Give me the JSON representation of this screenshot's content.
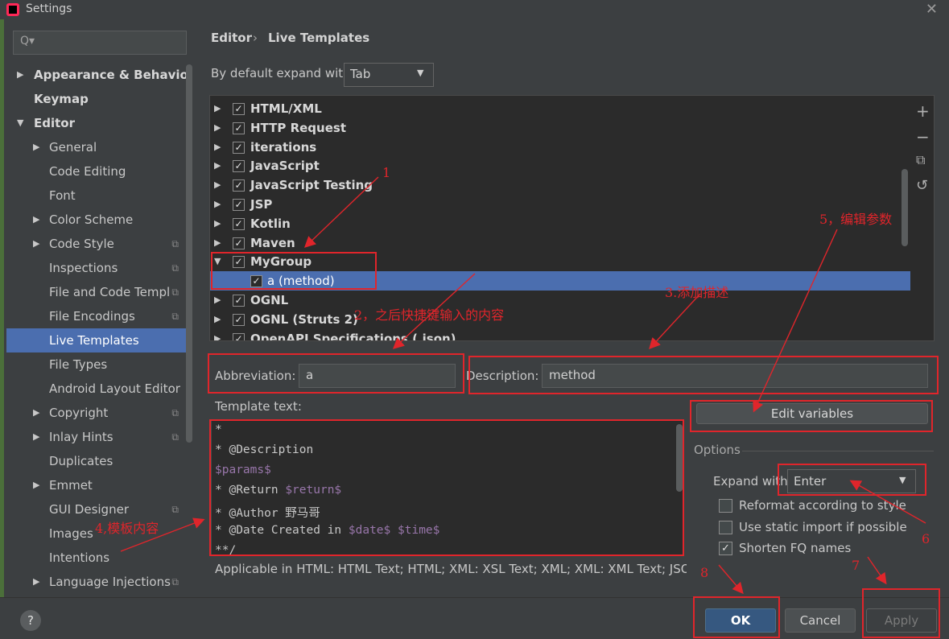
{
  "window": {
    "title": "Settings",
    "close": "✕"
  },
  "sidebar": {
    "search_icon": "Q▾",
    "items": [
      {
        "label": "Appearance & Behavior",
        "arrow": "▶"
      },
      {
        "label": "Keymap"
      },
      {
        "label": "Editor",
        "arrow": "▼"
      },
      {
        "label": "General",
        "arrow": "▶"
      },
      {
        "label": "Code Editing"
      },
      {
        "label": "Font"
      },
      {
        "label": "Color Scheme",
        "arrow": "▶"
      },
      {
        "label": "Code Style",
        "arrow": "▶",
        "copy": "⧉"
      },
      {
        "label": "Inspections",
        "copy": "⧉"
      },
      {
        "label": "File and Code Templ",
        "copy": "⧉"
      },
      {
        "label": "File Encodings",
        "copy": "⧉"
      },
      {
        "label": "Live Templates"
      },
      {
        "label": "File Types"
      },
      {
        "label": "Android Layout Editor"
      },
      {
        "label": "Copyright",
        "arrow": "▶",
        "copy": "⧉"
      },
      {
        "label": "Inlay Hints",
        "arrow": "▶",
        "copy": "⧉"
      },
      {
        "label": "Duplicates"
      },
      {
        "label": "Emmet",
        "arrow": "▶"
      },
      {
        "label": "GUI Designer",
        "copy": "⧉"
      },
      {
        "label": "Images"
      },
      {
        "label": "Intentions"
      },
      {
        "label": "Language Injections",
        "arrow": "▶",
        "copy": "⧉"
      }
    ]
  },
  "breadcrumb": {
    "parent": "Editor",
    "separator": "›",
    "current": "Live Templates"
  },
  "expand_default": {
    "label": "By default expand with",
    "value": "Tab",
    "arrow": "▼"
  },
  "tree": {
    "rows": [
      {
        "arrow": "▶",
        "check": "✓",
        "label": "HTML/XML"
      },
      {
        "arrow": "▶",
        "check": "✓",
        "label": "HTTP Request"
      },
      {
        "arrow": "▶",
        "check": "✓",
        "label": "iterations"
      },
      {
        "arrow": "▶",
        "check": "✓",
        "label": "JavaScript"
      },
      {
        "arrow": "▶",
        "check": "✓",
        "label": "JavaScript Testing"
      },
      {
        "arrow": "▶",
        "check": "✓",
        "label": "JSP"
      },
      {
        "arrow": "▶",
        "check": "✓",
        "label": "Kotlin"
      },
      {
        "arrow": "▶",
        "check": "✓",
        "label": "Maven"
      },
      {
        "arrow": "▼",
        "check": "✓",
        "label": "MyGroup"
      },
      {
        "arrow": "",
        "check": "✓",
        "label": "a (method)"
      },
      {
        "arrow": "▶",
        "check": "✓",
        "label": "OGNL"
      },
      {
        "arrow": "▶",
        "check": "✓",
        "label": "OGNL (Struts 2)"
      },
      {
        "arrow": "▶",
        "check": "✓",
        "label": "OpenAPI Specifications (.json)"
      }
    ],
    "tools": {
      "add": "+",
      "remove": "−",
      "copy": "⧉",
      "restore": "↺"
    }
  },
  "abbreviation": {
    "label": "Abbreviation:",
    "value": "a"
  },
  "description": {
    "label": "Description:",
    "value": "method"
  },
  "template_text": {
    "label": "Template text:",
    "lines": [
      [
        {
          "t": "*"
        }
      ],
      [
        {
          "t": "* @Description"
        }
      ],
      [
        {
          "t": "$params$",
          "v": true
        }
      ],
      [
        {
          "t": "* @Return "
        },
        {
          "t": "$return$",
          "v": true
        }
      ],
      [
        {
          "t": "* @Author 野马哥"
        }
      ],
      [
        {
          "t": "* @Date Created in "
        },
        {
          "t": "$date$",
          "v": true
        },
        {
          "t": " "
        },
        {
          "t": "$time$",
          "v": true
        }
      ],
      [
        {
          "t": "**/"
        }
      ]
    ]
  },
  "applicable": "Applicable in HTML: HTML Text; HTML; XML: XSL Text; XML; XML: XML Text; JSON; JSON",
  "edit_variables": "Edit variables",
  "options": {
    "title": "Options",
    "expand_with_label": "Expand with",
    "expand_with_value": "Enter",
    "expand_with_arrow": "▼",
    "checkboxes": [
      {
        "label": "Reformat according to style",
        "checked": false,
        "mark": ""
      },
      {
        "label": "Use static import if possible",
        "checked": false,
        "mark": ""
      },
      {
        "label": "Shorten FQ names",
        "checked": true,
        "mark": "✓"
      }
    ]
  },
  "footer": {
    "help": "?",
    "ok": "OK",
    "cancel": "Cancel",
    "apply": "Apply"
  },
  "annotations": {
    "a1": "1",
    "a2": "2，之后快捷键输入的内容",
    "a3": "3.添加描述",
    "a4": "4,模板内容",
    "a5": "5，编辑参数",
    "a6": "6",
    "a7": "7",
    "a8": "8"
  },
  "colors": {
    "accent": "#4b6eaf",
    "annotation": "#e0252b",
    "variable": "#9876aa",
    "ok_button": "#365880"
  }
}
